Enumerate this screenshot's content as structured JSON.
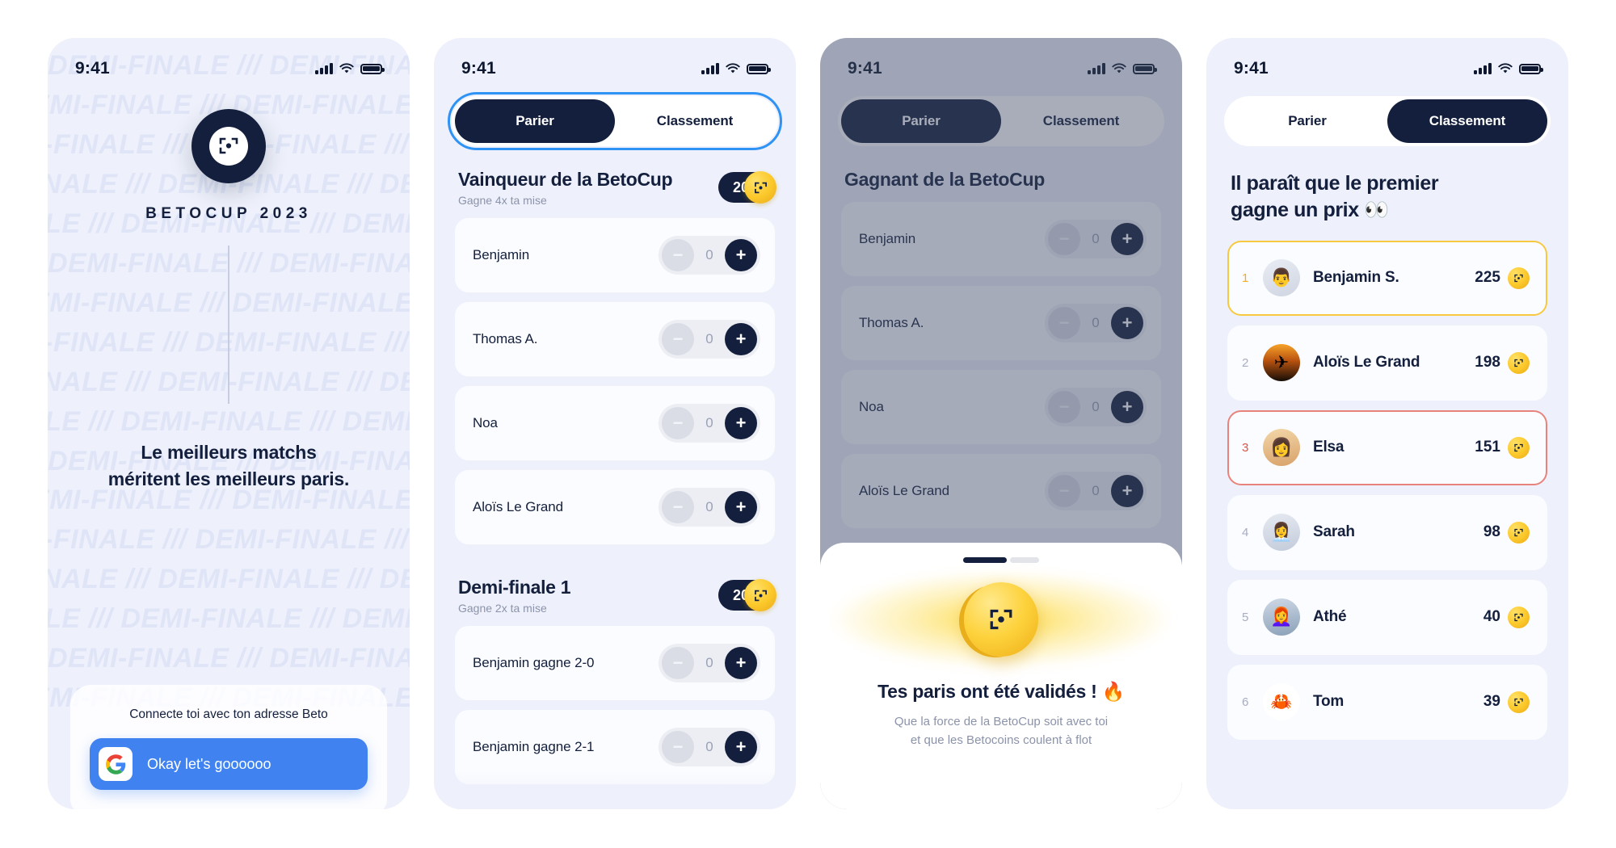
{
  "status_bar": {
    "time": "9:41",
    "signal_icon": "cellular-bars-icon",
    "wifi_icon": "wifi-icon",
    "battery_icon": "battery-full-icon"
  },
  "splash": {
    "watermark_text": "DEMI-FINALE /// DEMI-FINALE /// DEMI-FINALE /// DEMI-FINALE ///",
    "logo_icon": "betocup-logo-icon",
    "brand_title": "BETOCUP 2023",
    "tagline_line1": "Le meilleurs matchs",
    "tagline_line2": "méritent les meilleurs paris.",
    "login_label": "Connecte toi avec ton adresse Beto",
    "google_button_label": "Okay let's goooooo",
    "google_icon": "google-g-icon"
  },
  "tabs": {
    "bet_label": "Parier",
    "ranking_label": "Classement"
  },
  "bet_screen": {
    "sections": [
      {
        "title": "Vainqueur de la BetoCup",
        "subtitle": "Gagne 4x ta mise",
        "multiplier_coins": "20",
        "rows": [
          {
            "name": "Benjamin",
            "value": "0"
          },
          {
            "name": "Thomas A.",
            "value": "0"
          },
          {
            "name": "Noa",
            "value": "0"
          },
          {
            "name": "Aloïs Le Grand",
            "value": "0"
          }
        ]
      },
      {
        "title": "Demi-finale 1",
        "subtitle": "Gagne 2x ta mise",
        "multiplier_coins": "20",
        "rows": [
          {
            "name": "Benjamin gagne 2-0",
            "value": "0"
          },
          {
            "name": "Benjamin gagne 2-1",
            "value": "0"
          }
        ]
      }
    ],
    "stepper": {
      "minus_icon": "minus-icon",
      "plus_icon": "plus-icon"
    }
  },
  "confirm_screen": {
    "section_title": "Gagnant de la BetoCup",
    "rows": [
      {
        "name": "Benjamin",
        "value": "0"
      },
      {
        "name": "Thomas A.",
        "value": "0"
      },
      {
        "name": "Noa",
        "value": "0"
      },
      {
        "name": "Aloïs Le Grand",
        "value": "0"
      }
    ],
    "sheet": {
      "coin_icon": "gold-coin-icon",
      "title": "Tes paris ont été validés ! 🔥",
      "subtitle_line1": "Que la force de la BetoCup soit avec toi",
      "subtitle_line2": "et que les Betocoins coulent à flot"
    }
  },
  "leaderboard": {
    "title_line1": "Il paraît que le premier",
    "title_line2": "gagne un prix 👀",
    "rows": [
      {
        "rank": "1",
        "name": "Benjamin S.",
        "score": "225",
        "avatar": "👨",
        "highlight": "gold"
      },
      {
        "rank": "2",
        "name": "Aloïs Le Grand",
        "score": "198",
        "avatar": "✈",
        "highlight": "none"
      },
      {
        "rank": "3",
        "name": "Elsa",
        "score": "151",
        "avatar": "👩",
        "highlight": "red"
      },
      {
        "rank": "4",
        "name": "Sarah",
        "score": "98",
        "avatar": "👩‍💼",
        "highlight": "none"
      },
      {
        "rank": "5",
        "name": "Athé",
        "score": "40",
        "avatar": "👩‍🦰",
        "highlight": "none"
      },
      {
        "rank": "6",
        "name": "Tom",
        "score": "39",
        "avatar": "🦀",
        "highlight": "none"
      }
    ]
  },
  "colors": {
    "navy": "#131f3c",
    "background": "#eef1fb",
    "card": "#fbfcff",
    "gold": "#fcc92b",
    "blue_accent": "#4083f0",
    "focus_ring": "#2f93f5",
    "red_accent": "#e8837c"
  }
}
